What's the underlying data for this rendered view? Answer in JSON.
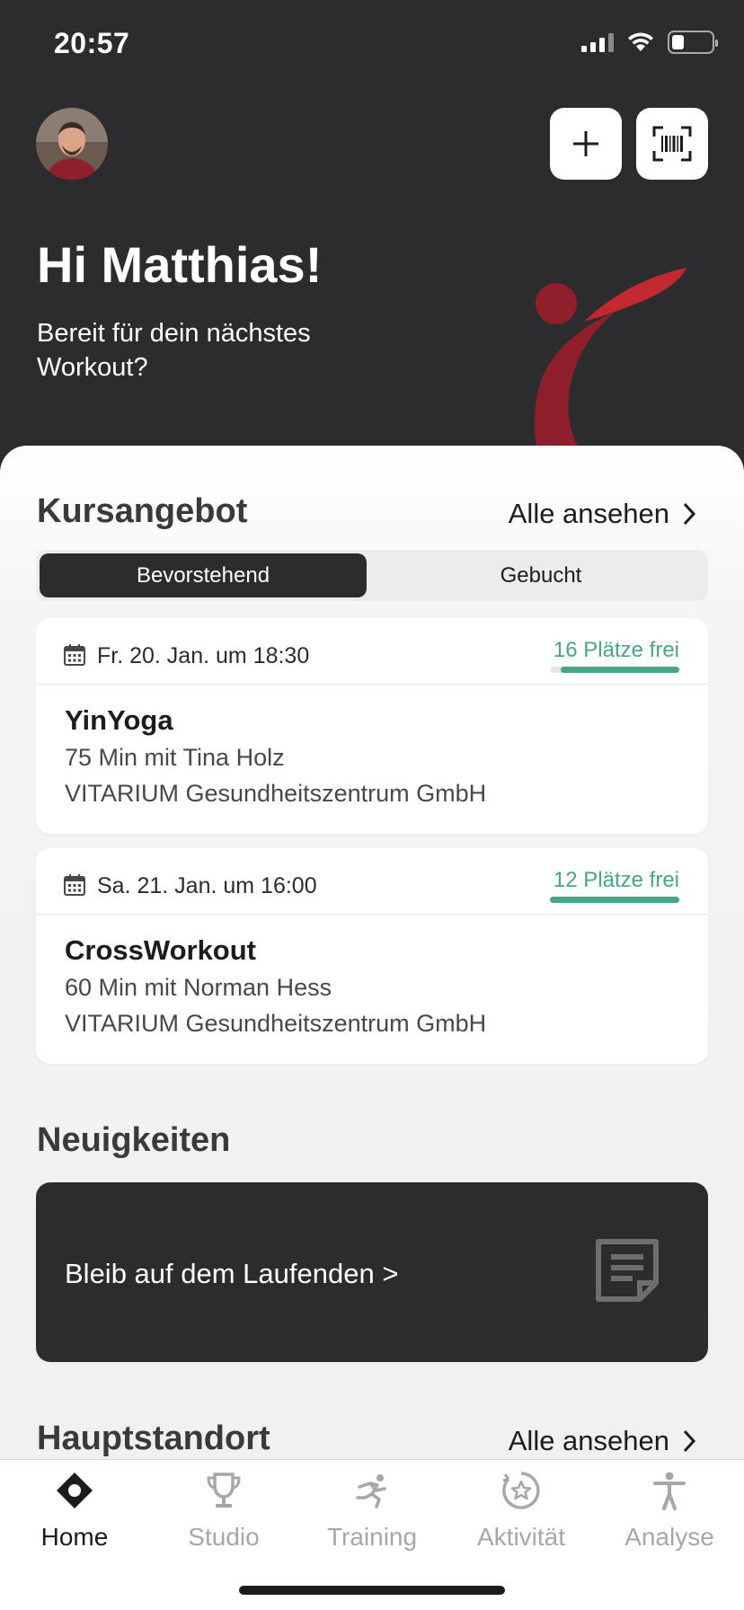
{
  "status_bar": {
    "time": "20:57"
  },
  "header": {
    "greeting": "Hi Matthias!",
    "subtitle": "Bereit für dein nächstes Workout?"
  },
  "courses": {
    "title": "Kursangebot",
    "see_all": "Alle ansehen",
    "tabs": [
      "Bevorstehend",
      "Gebucht"
    ],
    "items": [
      {
        "date": "Fr. 20. Jan. um 18:30",
        "spots": "16 Plätze frei",
        "spots_fill": 0.92,
        "name": "YinYoga",
        "detail": "75 Min mit Tina Holz",
        "location": "VITARIUM Gesundheitszentrum GmbH"
      },
      {
        "date": "Sa. 21. Jan. um 16:00",
        "spots": "12 Plätze frei",
        "spots_fill": 1.0,
        "name": "CrossWorkout",
        "detail": "60 Min mit Norman Hess",
        "location": "VITARIUM Gesundheitszentrum GmbH"
      }
    ]
  },
  "news": {
    "title": "Neuigkeiten",
    "card_text": "Bleib auf dem Laufenden >"
  },
  "location": {
    "title": "Hauptstandort",
    "see_all": "Alle ansehen"
  },
  "tabbar": {
    "items": [
      {
        "label": "Home",
        "icon": "home-icon"
      },
      {
        "label": "Studio",
        "icon": "trophy-icon"
      },
      {
        "label": "Training",
        "icon": "runner-icon"
      },
      {
        "label": "Aktivität",
        "icon": "star-badge-icon"
      },
      {
        "label": "Analyse",
        "icon": "person-icon"
      }
    ]
  },
  "colors": {
    "dark": "#2c2c2e",
    "accent_green": "#4aa586",
    "brand_red": "#b5262f"
  }
}
